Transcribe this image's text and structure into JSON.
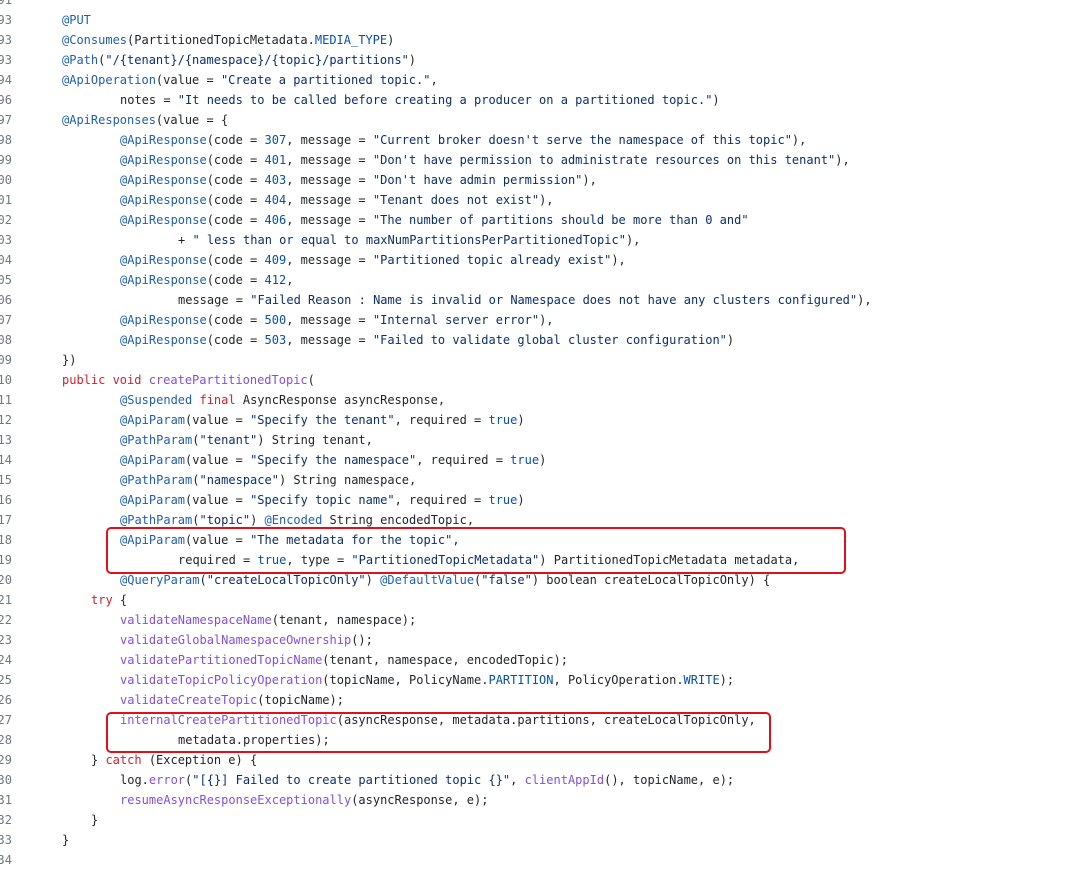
{
  "editor": {
    "lines": [
      {
        "num": "91",
        "indent": 0,
        "tokens": []
      },
      {
        "num": "93",
        "indent": 0,
        "tokens": [
          {
            "t": "ann",
            "v": "@PUT"
          }
        ]
      },
      {
        "num": "93",
        "indent": 0,
        "tokens": [
          {
            "t": "ann",
            "v": "@Consumes"
          },
          {
            "t": "plain",
            "v": "(PartitionedTopicMetadata."
          },
          {
            "t": "cst",
            "v": "MEDIA_TYPE"
          },
          {
            "t": "plain",
            "v": ")"
          }
        ]
      },
      {
        "num": "93",
        "indent": 0,
        "tokens": [
          {
            "t": "ann",
            "v": "@Path"
          },
          {
            "t": "plain",
            "v": "("
          },
          {
            "t": "str",
            "v": "\"/{tenant}/{namespace}/{topic}/partitions\""
          },
          {
            "t": "plain",
            "v": ")"
          }
        ]
      },
      {
        "num": "94",
        "indent": 0,
        "tokens": [
          {
            "t": "ann",
            "v": "@ApiOperation"
          },
          {
            "t": "plain",
            "v": "(value = "
          },
          {
            "t": "str",
            "v": "\"Create a partitioned topic.\""
          },
          {
            "t": "plain",
            "v": ","
          }
        ]
      },
      {
        "num": "96",
        "indent": 8,
        "tokens": [
          {
            "t": "plain",
            "v": "notes = "
          },
          {
            "t": "str",
            "v": "\"It needs to be called before creating a producer on a partitioned topic.\""
          },
          {
            "t": "plain",
            "v": ")"
          }
        ]
      },
      {
        "num": "97",
        "indent": 0,
        "tokens": [
          {
            "t": "ann",
            "v": "@ApiResponses"
          },
          {
            "t": "plain",
            "v": "(value = {"
          }
        ]
      },
      {
        "num": "98",
        "indent": 8,
        "tokens": [
          {
            "t": "ann",
            "v": "@ApiResponse"
          },
          {
            "t": "plain",
            "v": "(code = "
          },
          {
            "t": "num",
            "v": "307"
          },
          {
            "t": "plain",
            "v": ", message = "
          },
          {
            "t": "str",
            "v": "\"Current broker doesn't serve the namespace of this topic\""
          },
          {
            "t": "plain",
            "v": "),"
          }
        ]
      },
      {
        "num": "99",
        "indent": 8,
        "tokens": [
          {
            "t": "ann",
            "v": "@ApiResponse"
          },
          {
            "t": "plain",
            "v": "(code = "
          },
          {
            "t": "num",
            "v": "401"
          },
          {
            "t": "plain",
            "v": ", message = "
          },
          {
            "t": "str",
            "v": "\"Don't have permission to administrate resources on this tenant\""
          },
          {
            "t": "plain",
            "v": "),"
          }
        ]
      },
      {
        "num": "00",
        "indent": 8,
        "tokens": [
          {
            "t": "ann",
            "v": "@ApiResponse"
          },
          {
            "t": "plain",
            "v": "(code = "
          },
          {
            "t": "num",
            "v": "403"
          },
          {
            "t": "plain",
            "v": ", message = "
          },
          {
            "t": "str",
            "v": "\"Don't have admin permission\""
          },
          {
            "t": "plain",
            "v": "),"
          }
        ]
      },
      {
        "num": "01",
        "indent": 8,
        "tokens": [
          {
            "t": "ann",
            "v": "@ApiResponse"
          },
          {
            "t": "plain",
            "v": "(code = "
          },
          {
            "t": "num",
            "v": "404"
          },
          {
            "t": "plain",
            "v": ", message = "
          },
          {
            "t": "str",
            "v": "\"Tenant does not exist\""
          },
          {
            "t": "plain",
            "v": "),"
          }
        ]
      },
      {
        "num": "02",
        "indent": 8,
        "tokens": [
          {
            "t": "ann",
            "v": "@ApiResponse"
          },
          {
            "t": "plain",
            "v": "(code = "
          },
          {
            "t": "num",
            "v": "406"
          },
          {
            "t": "plain",
            "v": ", message = "
          },
          {
            "t": "str",
            "v": "\"The number of partitions should be more than 0 and\""
          }
        ]
      },
      {
        "num": "03",
        "indent": 16,
        "tokens": [
          {
            "t": "plain",
            "v": "+ "
          },
          {
            "t": "str",
            "v": "\" less than or equal to maxNumPartitionsPerPartitionedTopic\""
          },
          {
            "t": "plain",
            "v": "),"
          }
        ]
      },
      {
        "num": "04",
        "indent": 8,
        "tokens": [
          {
            "t": "ann",
            "v": "@ApiResponse"
          },
          {
            "t": "plain",
            "v": "(code = "
          },
          {
            "t": "num",
            "v": "409"
          },
          {
            "t": "plain",
            "v": ", message = "
          },
          {
            "t": "str",
            "v": "\"Partitioned topic already exist\""
          },
          {
            "t": "plain",
            "v": "),"
          }
        ]
      },
      {
        "num": "05",
        "indent": 8,
        "tokens": [
          {
            "t": "ann",
            "v": "@ApiResponse"
          },
          {
            "t": "plain",
            "v": "(code = "
          },
          {
            "t": "num",
            "v": "412"
          },
          {
            "t": "plain",
            "v": ","
          }
        ]
      },
      {
        "num": "06",
        "indent": 16,
        "tokens": [
          {
            "t": "plain",
            "v": "message = "
          },
          {
            "t": "str",
            "v": "\"Failed Reason : Name is invalid or Namespace does not have any clusters configured\""
          },
          {
            "t": "plain",
            "v": "),"
          }
        ]
      },
      {
        "num": "07",
        "indent": 8,
        "tokens": [
          {
            "t": "ann",
            "v": "@ApiResponse"
          },
          {
            "t": "plain",
            "v": "(code = "
          },
          {
            "t": "num",
            "v": "500"
          },
          {
            "t": "plain",
            "v": ", message = "
          },
          {
            "t": "str",
            "v": "\"Internal server error\""
          },
          {
            "t": "plain",
            "v": "),"
          }
        ]
      },
      {
        "num": "08",
        "indent": 8,
        "tokens": [
          {
            "t": "ann",
            "v": "@ApiResponse"
          },
          {
            "t": "plain",
            "v": "(code = "
          },
          {
            "t": "num",
            "v": "503"
          },
          {
            "t": "plain",
            "v": ", message = "
          },
          {
            "t": "str",
            "v": "\"Failed to validate global cluster configuration\""
          },
          {
            "t": "plain",
            "v": ")"
          }
        ]
      },
      {
        "num": "09",
        "indent": 0,
        "tokens": [
          {
            "t": "plain",
            "v": "})"
          }
        ]
      },
      {
        "num": "10",
        "indent": 0,
        "tokens": [
          {
            "t": "kw",
            "v": "public void "
          },
          {
            "t": "fn",
            "v": "createPartitionedTopic"
          },
          {
            "t": "plain",
            "v": "("
          }
        ]
      },
      {
        "num": "11",
        "indent": 8,
        "tokens": [
          {
            "t": "ann",
            "v": "@Suspended "
          },
          {
            "t": "kw",
            "v": "final "
          },
          {
            "t": "plain",
            "v": "AsyncResponse asyncResponse,"
          }
        ]
      },
      {
        "num": "12",
        "indent": 8,
        "tokens": [
          {
            "t": "ann",
            "v": "@ApiParam"
          },
          {
            "t": "plain",
            "v": "(value = "
          },
          {
            "t": "str",
            "v": "\"Specify the tenant\""
          },
          {
            "t": "plain",
            "v": ", required = "
          },
          {
            "t": "num",
            "v": "true"
          },
          {
            "t": "plain",
            "v": ")"
          }
        ]
      },
      {
        "num": "13",
        "indent": 8,
        "tokens": [
          {
            "t": "ann",
            "v": "@PathParam"
          },
          {
            "t": "plain",
            "v": "("
          },
          {
            "t": "str",
            "v": "\"tenant\""
          },
          {
            "t": "plain",
            "v": ") String tenant,"
          }
        ]
      },
      {
        "num": "14",
        "indent": 8,
        "tokens": [
          {
            "t": "ann",
            "v": "@ApiParam"
          },
          {
            "t": "plain",
            "v": "(value = "
          },
          {
            "t": "str",
            "v": "\"Specify the namespace\""
          },
          {
            "t": "plain",
            "v": ", required = "
          },
          {
            "t": "num",
            "v": "true"
          },
          {
            "t": "plain",
            "v": ")"
          }
        ]
      },
      {
        "num": "15",
        "indent": 8,
        "tokens": [
          {
            "t": "ann",
            "v": "@PathParam"
          },
          {
            "t": "plain",
            "v": "("
          },
          {
            "t": "str",
            "v": "\"namespace\""
          },
          {
            "t": "plain",
            "v": ") String namespace,"
          }
        ]
      },
      {
        "num": "16",
        "indent": 8,
        "tokens": [
          {
            "t": "ann",
            "v": "@ApiParam"
          },
          {
            "t": "plain",
            "v": "(value = "
          },
          {
            "t": "str",
            "v": "\"Specify topic name\""
          },
          {
            "t": "plain",
            "v": ", required = "
          },
          {
            "t": "num",
            "v": "true"
          },
          {
            "t": "plain",
            "v": ")"
          }
        ]
      },
      {
        "num": "17",
        "indent": 8,
        "tokens": [
          {
            "t": "ann",
            "v": "@PathParam"
          },
          {
            "t": "plain",
            "v": "("
          },
          {
            "t": "str",
            "v": "\"topic\""
          },
          {
            "t": "plain",
            "v": ") "
          },
          {
            "t": "ann",
            "v": "@Encoded "
          },
          {
            "t": "plain",
            "v": "String encodedTopic,"
          }
        ]
      },
      {
        "num": "18",
        "indent": 8,
        "tokens": [
          {
            "t": "ann",
            "v": "@ApiParam"
          },
          {
            "t": "plain",
            "v": "(value = "
          },
          {
            "t": "str",
            "v": "\"The metadata for the topic\""
          },
          {
            "t": "plain",
            "v": ","
          }
        ]
      },
      {
        "num": "19",
        "indent": 16,
        "tokens": [
          {
            "t": "plain",
            "v": "required = "
          },
          {
            "t": "num",
            "v": "true"
          },
          {
            "t": "plain",
            "v": ", type = "
          },
          {
            "t": "str",
            "v": "\"PartitionedTopicMetadata\""
          },
          {
            "t": "plain",
            "v": ") PartitionedTopicMetadata metadata,"
          }
        ]
      },
      {
        "num": "20",
        "indent": 8,
        "tokens": [
          {
            "t": "ann",
            "v": "@QueryParam"
          },
          {
            "t": "plain",
            "v": "("
          },
          {
            "t": "str",
            "v": "\"createLocalTopicOnly\""
          },
          {
            "t": "plain",
            "v": ") "
          },
          {
            "t": "ann",
            "v": "@DefaultValue"
          },
          {
            "t": "plain",
            "v": "("
          },
          {
            "t": "str",
            "v": "\"false\""
          },
          {
            "t": "plain",
            "v": ") boolean createLocalTopicOnly) {"
          }
        ]
      },
      {
        "num": "21",
        "indent": 4,
        "tokens": [
          {
            "t": "kw",
            "v": "try "
          },
          {
            "t": "plain",
            "v": "{"
          }
        ]
      },
      {
        "num": "22",
        "indent": 8,
        "tokens": [
          {
            "t": "fn",
            "v": "validateNamespaceName"
          },
          {
            "t": "plain",
            "v": "(tenant, namespace);"
          }
        ]
      },
      {
        "num": "23",
        "indent": 8,
        "tokens": [
          {
            "t": "fn",
            "v": "validateGlobalNamespaceOwnership"
          },
          {
            "t": "plain",
            "v": "();"
          }
        ]
      },
      {
        "num": "24",
        "indent": 8,
        "tokens": [
          {
            "t": "fn",
            "v": "validatePartitionedTopicName"
          },
          {
            "t": "plain",
            "v": "(tenant, namespace, encodedTopic);"
          }
        ]
      },
      {
        "num": "25",
        "indent": 8,
        "tokens": [
          {
            "t": "fn",
            "v": "validateTopicPolicyOperation"
          },
          {
            "t": "plain",
            "v": "(topicName, PolicyName."
          },
          {
            "t": "cst",
            "v": "PARTITION"
          },
          {
            "t": "plain",
            "v": ", PolicyOperation."
          },
          {
            "t": "cst",
            "v": "WRITE"
          },
          {
            "t": "plain",
            "v": ");"
          }
        ]
      },
      {
        "num": "26",
        "indent": 8,
        "tokens": [
          {
            "t": "fn",
            "v": "validateCreateTopic"
          },
          {
            "t": "plain",
            "v": "(topicName);"
          }
        ]
      },
      {
        "num": "27",
        "indent": 8,
        "tokens": [
          {
            "t": "fn",
            "v": "internalCreatePartitionedTopic"
          },
          {
            "t": "plain",
            "v": "(asyncResponse, metadata.partitions, createLocalTopicOnly,"
          }
        ]
      },
      {
        "num": "28",
        "indent": 16,
        "tokens": [
          {
            "t": "plain",
            "v": "metadata.properties);"
          }
        ]
      },
      {
        "num": "29",
        "indent": 4,
        "tokens": [
          {
            "t": "plain",
            "v": "} "
          },
          {
            "t": "kw",
            "v": "catch "
          },
          {
            "t": "plain",
            "v": "(Exception e) {"
          }
        ]
      },
      {
        "num": "30",
        "indent": 8,
        "tokens": [
          {
            "t": "plain",
            "v": "log."
          },
          {
            "t": "fn",
            "v": "error"
          },
          {
            "t": "plain",
            "v": "("
          },
          {
            "t": "str",
            "v": "\"[{}] Failed to create partitioned topic {}\""
          },
          {
            "t": "plain",
            "v": ", "
          },
          {
            "t": "fn",
            "v": "clientAppId"
          },
          {
            "t": "plain",
            "v": "(), topicName, e);"
          }
        ]
      },
      {
        "num": "31",
        "indent": 8,
        "tokens": [
          {
            "t": "fn",
            "v": "resumeAsyncResponseExceptionally"
          },
          {
            "t": "plain",
            "v": "(asyncResponse, e);"
          }
        ]
      },
      {
        "num": "32",
        "indent": 4,
        "tokens": [
          {
            "t": "plain",
            "v": "}"
          }
        ]
      },
      {
        "num": "33",
        "indent": 0,
        "tokens": [
          {
            "t": "plain",
            "v": "}"
          }
        ]
      },
      {
        "num": "34",
        "indent": 0,
        "tokens": []
      }
    ]
  },
  "highlight_color": "#e0101a"
}
